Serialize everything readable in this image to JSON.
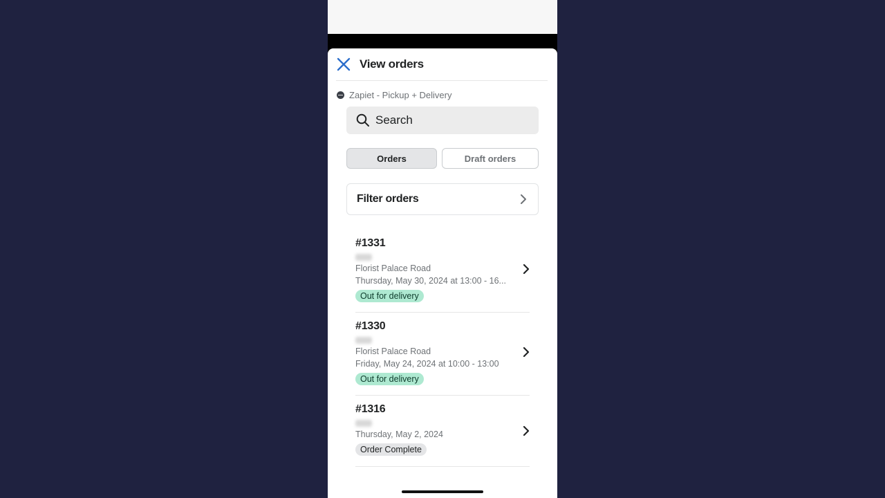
{
  "header": {
    "title": "View orders"
  },
  "app": {
    "name": "Zapiet - Pickup + Delivery"
  },
  "search": {
    "placeholder": "Search"
  },
  "tabs": [
    {
      "label": "Orders",
      "active": true
    },
    {
      "label": "Draft orders",
      "active": false
    }
  ],
  "filter": {
    "label": "Filter orders"
  },
  "orders": [
    {
      "number": "#1331",
      "location": "Florist Palace Road",
      "date": "Thursday, May 30, 2024 at 13:00 - 16...",
      "status": "Out for delivery"
    },
    {
      "number": "#1330",
      "location": "Florist Palace Road",
      "date": "Friday, May 24, 2024 at 10:00 - 13:00",
      "status": "Out for delivery"
    },
    {
      "number": "#1316",
      "date": "Thursday, May 2, 2024",
      "status": "Order Complete"
    }
  ],
  "colors": {
    "accent": "#2c6ecb",
    "status_green": "#aee9d1",
    "status_grey": "#e4e5e7"
  }
}
